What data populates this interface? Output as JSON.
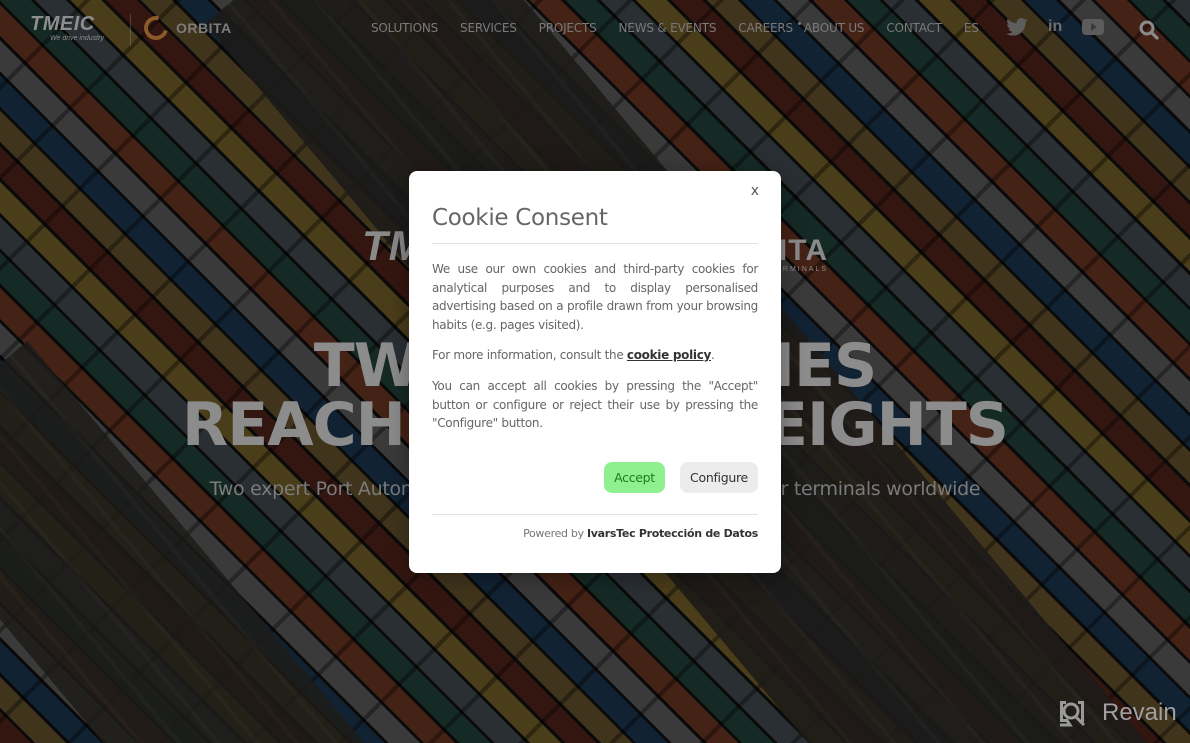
{
  "header": {
    "logo_primary": "TMEIC",
    "logo_tagline": "We drive industry",
    "logo_secondary": "ORBITA",
    "nav": [
      {
        "label": "SOLUTIONS"
      },
      {
        "label": "SERVICES"
      },
      {
        "label": "PROJECTS"
      },
      {
        "label": "NEWS & EVENTS"
      },
      {
        "label": "CAREERS"
      },
      {
        "label": "ABOUT US"
      },
      {
        "label": "CONTACT"
      },
      {
        "label": "ES"
      }
    ],
    "social": [
      "twitter-icon",
      "linkedin-icon",
      "youtube-icon"
    ],
    "linkedin_glyph": "in",
    "search_icon": "search-icon"
  },
  "hero": {
    "logo_left": "TMEIC",
    "logo_right": "ORBITA",
    "logo_right_sub": "TERMINALS",
    "headline_line1": "TWO COMPANIES",
    "headline_line2": "REACHING NEW HEIGHTS",
    "subtitle": "Two expert Port Automation companies delivering solutions for terminals worldwide"
  },
  "modal": {
    "close_label": "x",
    "title": "Cookie Consent",
    "paragraph1": "We use our own cookies and third-party cookies for analytical purposes and to display personalised advertising based on a profile drawn from your browsing habits (e.g. pages visited).",
    "paragraph2_prefix": "For more information, consult the ",
    "paragraph2_link": "cookie policy",
    "paragraph2_suffix": ".",
    "paragraph3": "You can accept all cookies by pressing the \"Accept\" button or configure or reject their use by pressing the \"Configure\" button.",
    "accept_label": "Accept",
    "configure_label": "Configure",
    "powered_prefix": "Powered by ",
    "powered_brand": "IvarsTec Protección de Datos",
    "accept_color": "#8ef08e",
    "accept_text_color": "#1e7a1e"
  },
  "watermark": {
    "label": "Revain"
  }
}
